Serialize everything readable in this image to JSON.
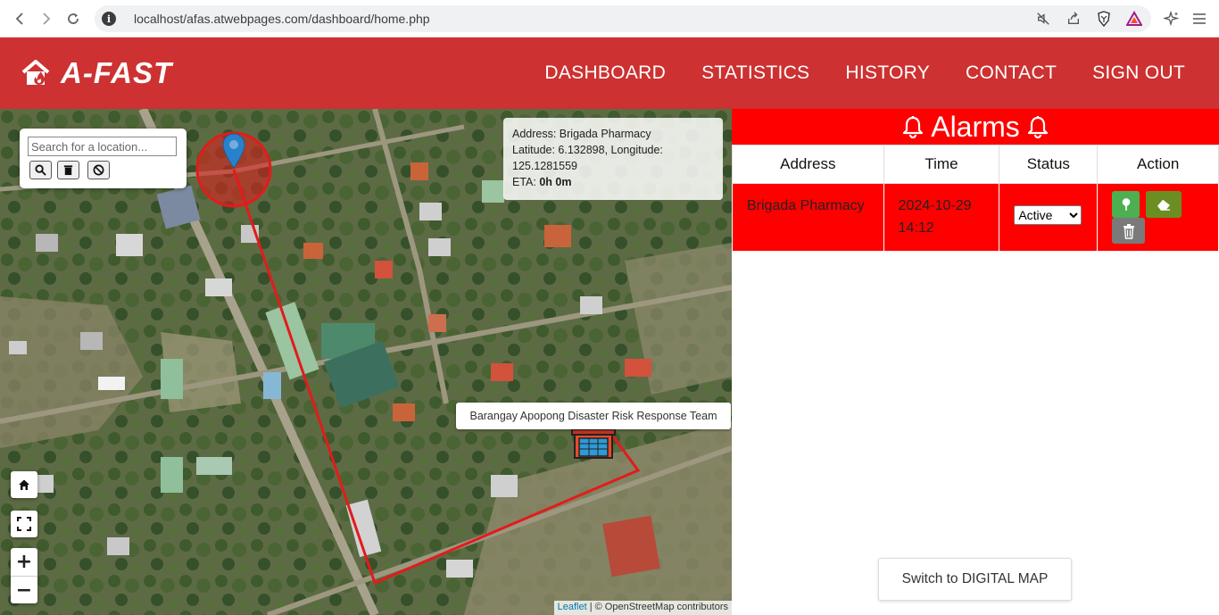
{
  "browser": {
    "url": "localhost/afas.atwebpages.com/dashboard/home.php"
  },
  "header": {
    "logo_text": "A-FAST",
    "nav": {
      "dashboard": "DASHBOARD",
      "statistics": "STATISTICS",
      "history": "HISTORY",
      "contact": "CONTACT",
      "sign_out": "SIGN OUT"
    }
  },
  "map": {
    "search_placeholder": "Search for a location...",
    "popup": {
      "address": "Address: Brigada Pharmacy",
      "latlng": "Latitude: 6.132898, Longitude: 125.1281559",
      "eta_label": "ETA: ",
      "eta_value": "0h 0m"
    },
    "team_label": "Barangay Apopong Disaster Risk Response Team",
    "zoom_in": "+",
    "zoom_out": "−",
    "attribution_link": "Leaflet",
    "attribution_text": " | © OpenStreetMap contributors"
  },
  "alarms": {
    "title": "Alarms",
    "columns": {
      "address": "Address",
      "time": "Time",
      "status": "Status",
      "action": "Action"
    },
    "rows": [
      {
        "address": "Brigada Pharmacy",
        "time": "2024-10-29 14:12",
        "status": "Active"
      }
    ],
    "switch_button": "Switch to DIGITAL MAP"
  },
  "colors": {
    "header_bg": "#cd3131",
    "alarm_red": "#ff0000",
    "route_red": "#e31b1b",
    "locate_green": "#4caf50",
    "erase_olive": "#6b8e23",
    "delete_gray": "#7a7a7a",
    "marker_blue": "#2a81cb"
  }
}
